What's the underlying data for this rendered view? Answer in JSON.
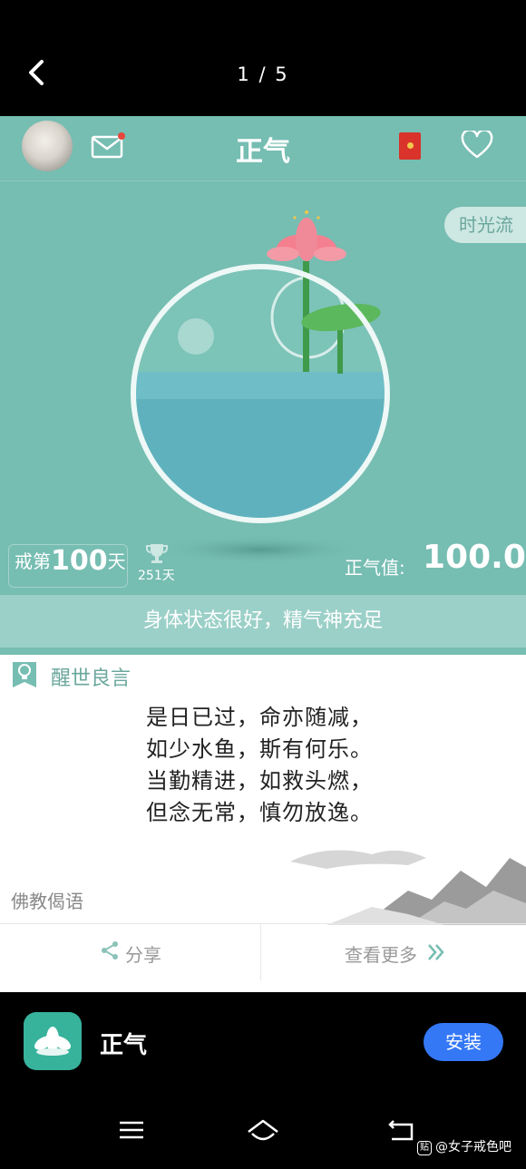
{
  "viewer": {
    "page_indicator": "1 / 5"
  },
  "app": {
    "title": "正气",
    "timeflow_label": "时光流",
    "streak": {
      "prefix": "戒第",
      "days": "100",
      "suffix": "天"
    },
    "best_days": "251天",
    "score_label": "正气值:",
    "score_value": "100.0",
    "status_text": "身体状态很好，精气神充足"
  },
  "quote_card": {
    "title": "醒世良言",
    "lines": [
      "是日已过，命亦随减，",
      "如少水鱼，斯有何乐。",
      "当勤精进，如救头燃，",
      "但念无常，慎勿放逸。"
    ],
    "source": "佛教偈语",
    "share_label": "分享",
    "more_label": "查看更多"
  },
  "install_bar": {
    "app_name": "正气",
    "install_label": "安装"
  },
  "watermark": {
    "badge": "贴",
    "text": "@女子戒色吧"
  },
  "colors": {
    "teal": "#76bdb2",
    "accent_blue": "#3478f6",
    "redpacket": "#d9332b"
  },
  "icons": [
    "back-icon",
    "mail-icon",
    "redpacket-icon",
    "heart-icon",
    "trophy-icon",
    "lightbulb-icon",
    "share-icon",
    "double-chevron-icon",
    "menu-icon",
    "home-icon",
    "back-nav-icon"
  ]
}
